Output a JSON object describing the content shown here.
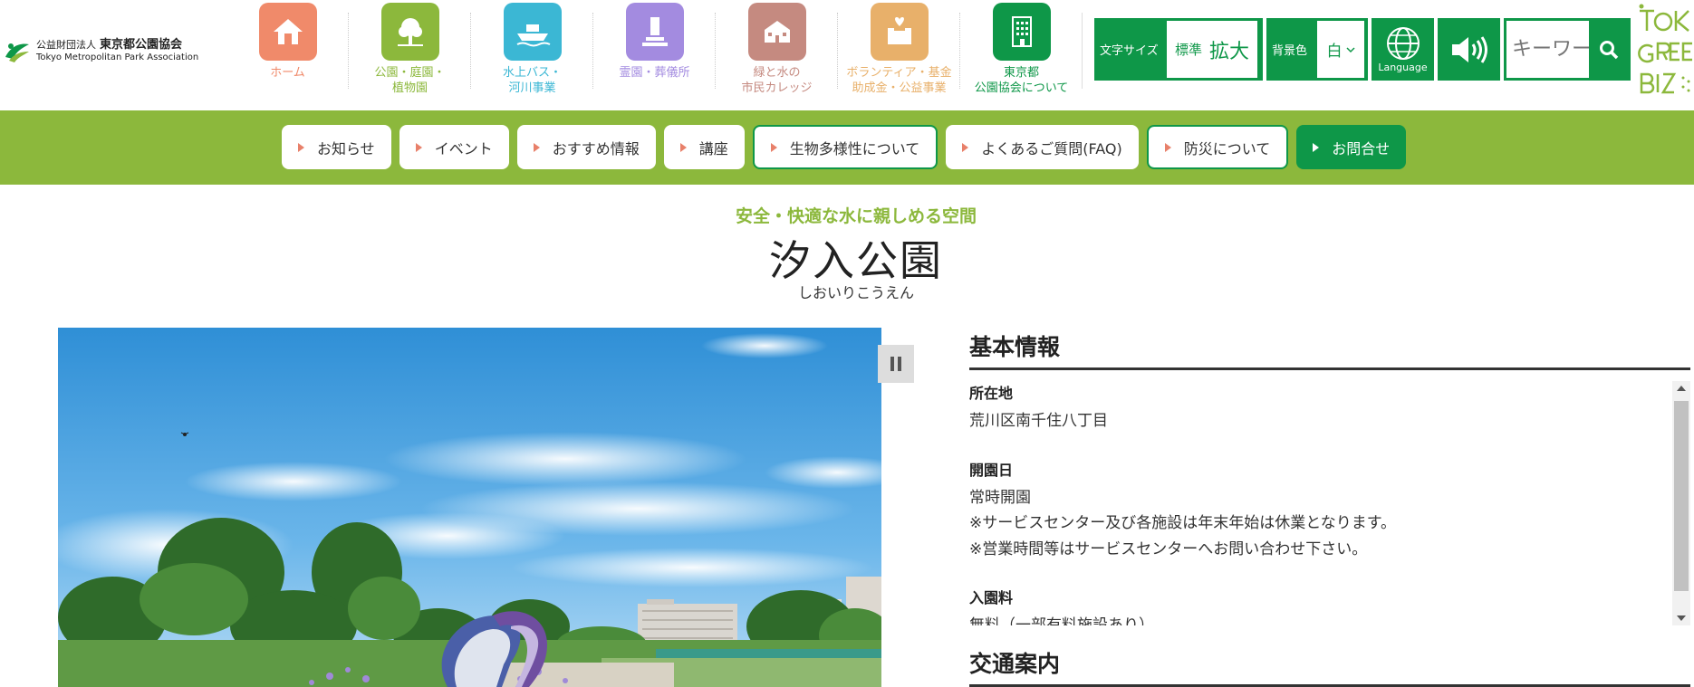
{
  "logo": {
    "prefix": "公益財団法人",
    "name": "東京都公園協会",
    "english": "Tokyo Metropolitan Park Association"
  },
  "nav": [
    {
      "label": "ホーム",
      "color": "#f08a6a",
      "text_color": "#f08a6a",
      "icon": "home-icon"
    },
    {
      "label": "公園・庭園・\n植物園",
      "color": "#8cb83c",
      "text_color": "#8cb83c",
      "icon": "tree-icon"
    },
    {
      "label": "水上バス・\n河川事業",
      "color": "#3bb7d4",
      "text_color": "#3bb7d4",
      "icon": "boat-icon"
    },
    {
      "label": "霊園・葬儀所",
      "color": "#a38be0",
      "text_color": "#a38be0",
      "icon": "monument-icon"
    },
    {
      "label": "緑と水の\n市民カレッジ",
      "color": "#c58a80",
      "text_color": "#c58a80",
      "icon": "school-icon"
    },
    {
      "label": "ボランティア・基金\n助成金・公益事業",
      "color": "#e8b06a",
      "text_color": "#e8b06a",
      "icon": "donation-box-icon"
    },
    {
      "label": "東京都\n公園協会について",
      "color": "#0e9748",
      "text_color": "#0e9748",
      "icon": "building-icon"
    }
  ],
  "tools": {
    "fontsize_label": "文字サイズ",
    "fontsize_standard": "標準",
    "fontsize_large": "拡大",
    "bgcolor_label": "背景色",
    "bgcolor_value": "白",
    "language_label": "Language",
    "search_placeholder": "キーワード"
  },
  "tg_logo": "TOKYO GREEN BIZ",
  "menu": [
    {
      "label": "お知らせ",
      "style": "plain"
    },
    {
      "label": "イベント",
      "style": "plain"
    },
    {
      "label": "おすすめ情報",
      "style": "plain"
    },
    {
      "label": "講座",
      "style": "plain"
    },
    {
      "label": "生物多様性について",
      "style": "outlined"
    },
    {
      "label": "よくあるご質問(FAQ)",
      "style": "plain"
    },
    {
      "label": "防災について",
      "style": "outlined"
    },
    {
      "label": "お問合せ",
      "style": "filled"
    }
  ],
  "page": {
    "subtitle": "安全・快適な水に親しめる空間",
    "title": "汐入公園",
    "reading": "しおいりこうえん"
  },
  "info": {
    "section_title": "基本情報",
    "items": [
      {
        "term": "所在地",
        "desc": [
          "荒川区南千住八丁目"
        ]
      },
      {
        "term": "開園日",
        "desc": [
          "常時開園",
          "※サービスセンター及び各施設は年末年始は休業となります。",
          "※営業時間等はサービスセンターへお問い合わせ下さい。"
        ]
      },
      {
        "term": "入園料",
        "desc": [
          "無料（一部有料施設あり）"
        ]
      }
    ],
    "section2_title": "交通案内"
  },
  "colors": {
    "brand_green": "#0e9748",
    "menu_green": "#8cb83c"
  }
}
